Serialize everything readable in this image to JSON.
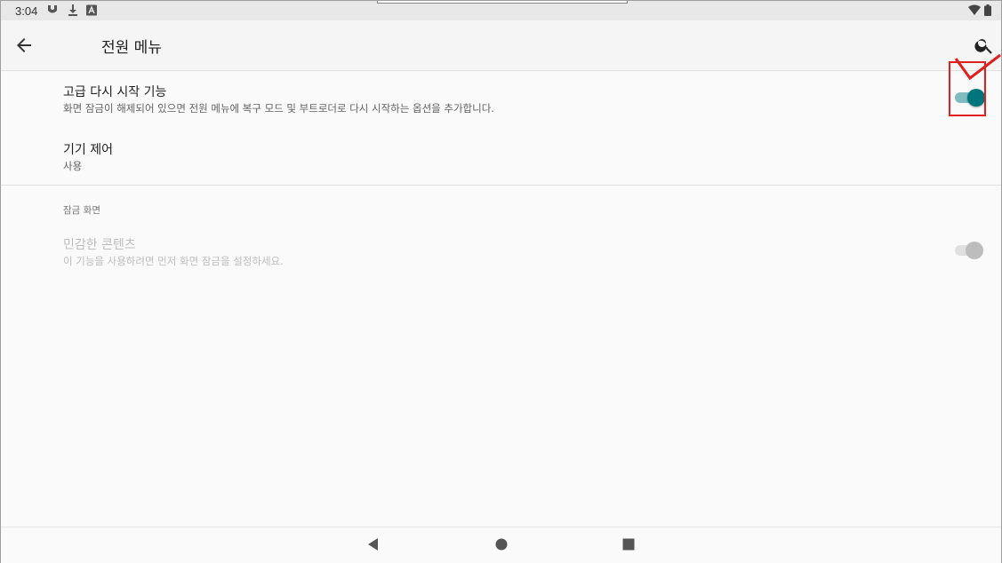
{
  "status_bar": {
    "time": "3:04",
    "icons": [
      "notification-icon",
      "download-icon",
      "a-icon",
      "wifi-icon",
      "battery-icon"
    ]
  },
  "app_bar": {
    "title": "전원 메뉴",
    "back_icon": "arrow-back-icon",
    "search_icon": "search-icon"
  },
  "settings": [
    {
      "title": "고급 다시 시작 기능",
      "summary": "화면 잠금이 해제되어 있으면 전원 메뉴에 복구 모드 및 부트로더로 다시 시작하는 옵션을 추가합니다.",
      "switch_on": true,
      "enabled": true
    },
    {
      "title": "기기 제어",
      "summary": "사용",
      "enabled": true
    }
  ],
  "lock_screen_section": {
    "header": "잠금 화면",
    "items": [
      {
        "title": "민감한 콘텐츠",
        "summary": "이 기능을 사용하려면 먼저 화면 잠금을 설정하세요.",
        "switch_on": false,
        "enabled": false
      }
    ]
  },
  "colors": {
    "accent": "#00767c",
    "annotation": "#e0201e"
  },
  "nav_bar": {
    "icons": [
      "back-triangle-icon",
      "home-circle-icon",
      "recents-square-icon"
    ]
  }
}
